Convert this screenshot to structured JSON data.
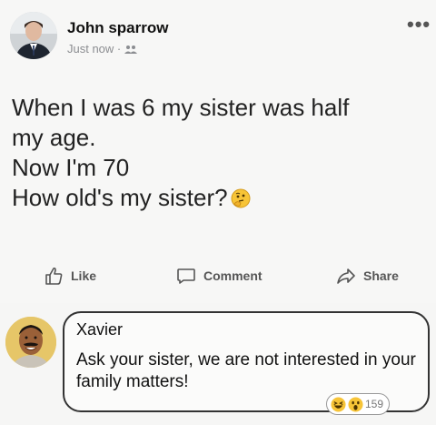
{
  "post": {
    "author": "John sparrow",
    "meta": "Just now ·",
    "lines": [
      "When I was 6 my sister was half",
      "my age.",
      "Now I'm 70",
      "How old's my sister?"
    ]
  },
  "actions": {
    "like": "Like",
    "comment": "Comment",
    "share": "Share"
  },
  "comment": {
    "name": "Xavier",
    "text": "Ask your sister, we are not interested in your family matters!",
    "reaction_count": "159"
  },
  "icons": {
    "author_avatar": "person-in-suit-avatar",
    "commenter_avatar": "smiling-man-avatar",
    "audience": "friends-icon",
    "post_emoji": "thinking-face-icon",
    "reactions": [
      "haha-icon",
      "wow-icon"
    ]
  },
  "colors": {
    "page_bg": "#f6f6f5",
    "text": "#1c1e21",
    "muted": "#8b8d91",
    "reaction_yellow": "#f7c437"
  }
}
